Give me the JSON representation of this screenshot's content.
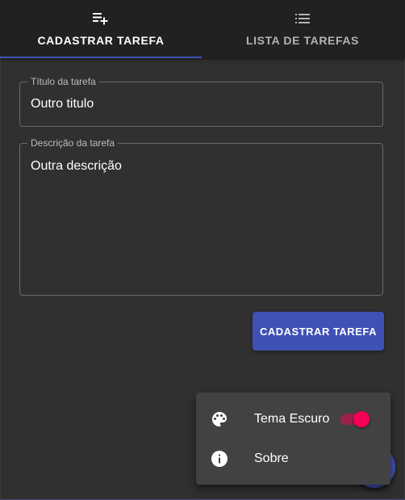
{
  "tabs": [
    {
      "label": "CADASTRAR TAREFA",
      "icon": "playlist-add-icon",
      "active": true
    },
    {
      "label": "LISTA DE TAREFAS",
      "icon": "list-icon",
      "active": false
    }
  ],
  "form": {
    "title_label": "Título da tarefa",
    "title_value": "Outro titulo",
    "description_label": "Descrição da tarefa",
    "description_value": "Outra descrição",
    "submit_label": "CADASTRAR TAREFA"
  },
  "menu": {
    "items": [
      {
        "label": "Tema Escuro",
        "icon": "palette-icon",
        "toggle_on": true
      },
      {
        "label": "Sobre",
        "icon": "info-icon"
      }
    ]
  },
  "colors": {
    "primary": "#3f51b5",
    "secondary": "#f50057",
    "background": "#303030",
    "appbar": "#212121",
    "menu": "#424242"
  }
}
